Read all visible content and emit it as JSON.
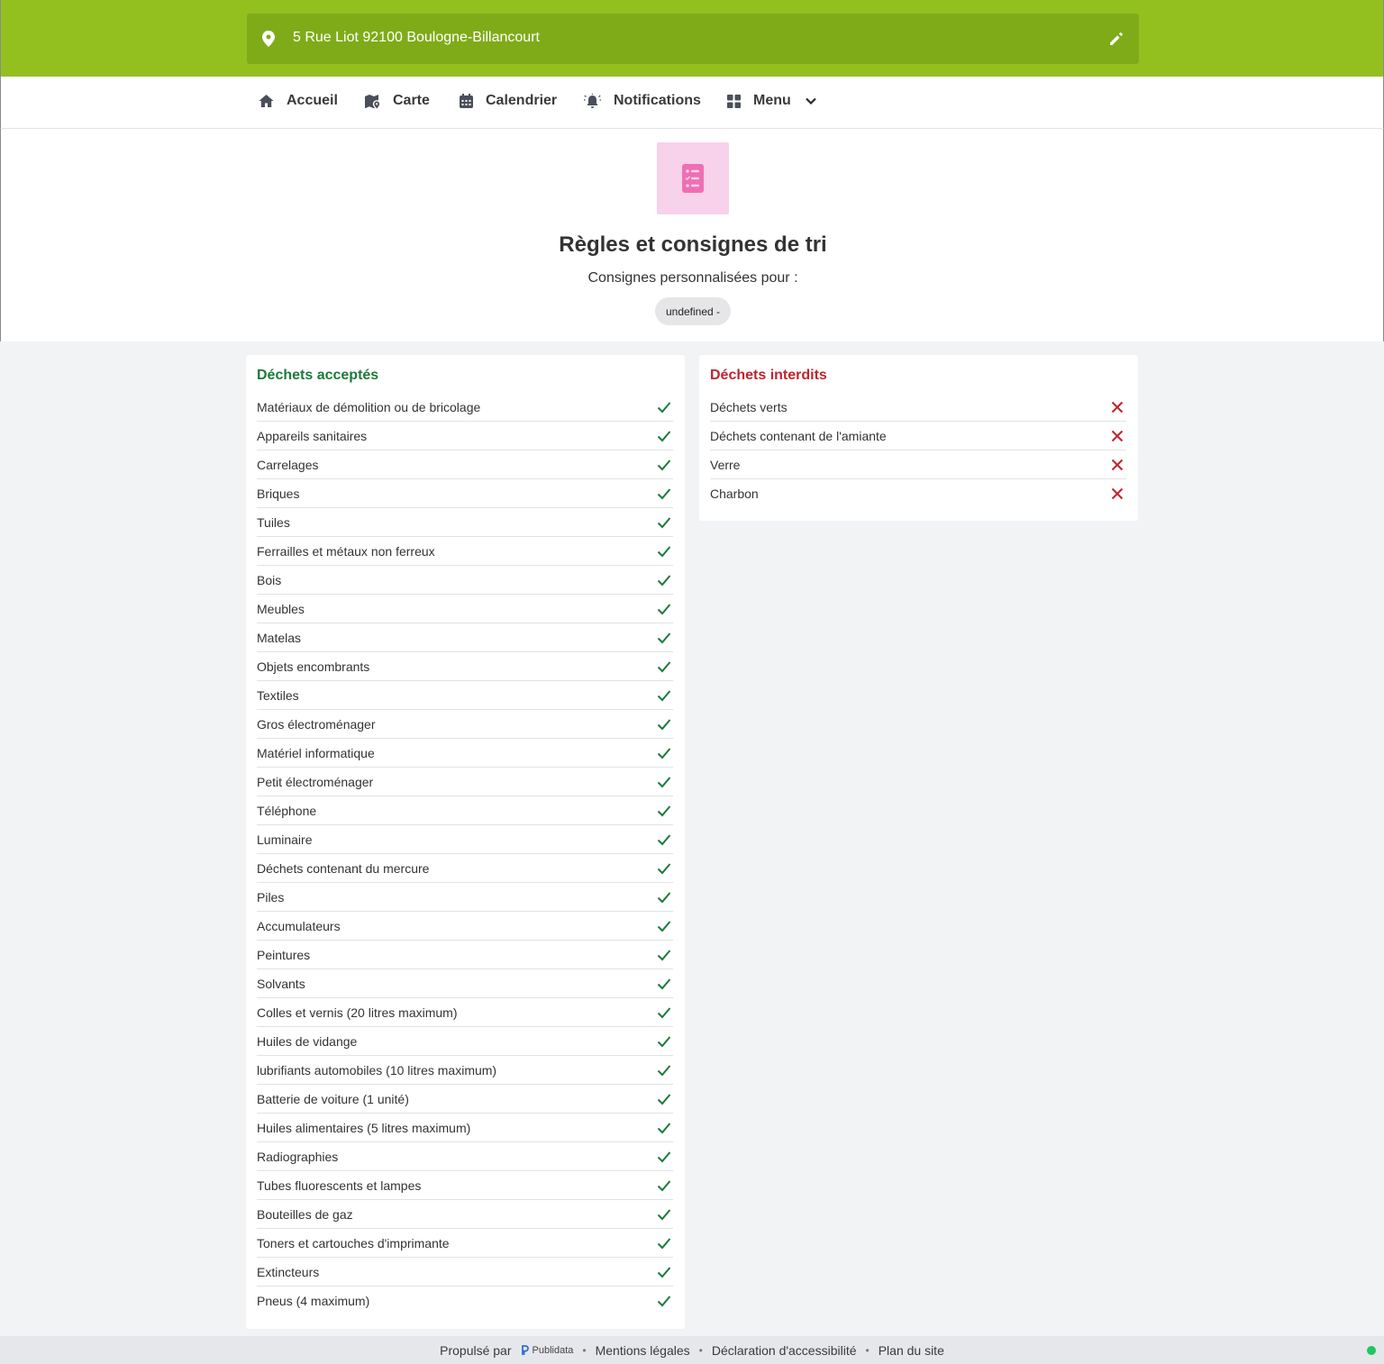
{
  "header": {
    "address": "5 Rue Liot 92100 Boulogne-Billancourt",
    "icons": {
      "location": "location-pin-icon",
      "edit": "pencil-icon"
    }
  },
  "nav": {
    "items": [
      {
        "label": "Accueil",
        "icon": "home-icon"
      },
      {
        "label": "Carte",
        "icon": "map-icon"
      },
      {
        "label": "Calendrier",
        "icon": "calendar-icon"
      },
      {
        "label": "Notifications",
        "icon": "bell-icon"
      },
      {
        "label": "Menu",
        "icon": "grid-icon"
      }
    ]
  },
  "hero": {
    "icon": "checklist-icon",
    "title": "Règles et consignes de tri",
    "subtitle": "Consignes personnalisées pour :",
    "chip": "undefined -"
  },
  "accepted": {
    "title": "Déchets acceptés",
    "items": [
      "Matériaux de démolition ou de bricolage",
      "Appareils sanitaires",
      "Carrelages",
      "Briques",
      "Tuiles",
      "Ferrailles et métaux non ferreux",
      "Bois",
      "Meubles",
      "Matelas",
      "Objets encombrants",
      "Textiles",
      "Gros électroménager",
      "Matériel informatique",
      "Petit électroménager",
      "Téléphone",
      "Luminaire",
      "Déchets contenant du mercure",
      "Piles",
      "Accumulateurs",
      "Peintures",
      "Solvants",
      "Colles et vernis (20 litres maximum)",
      "Huiles de vidange",
      "lubrifiants automobiles (10 litres maximum)",
      "Batterie de voiture (1 unité)",
      "Huiles alimentaires (5 litres maximum)",
      "Radiographies",
      "Tubes fluorescents et lampes",
      "Bouteilles de gaz",
      "Toners et cartouches d'imprimante",
      "Extincteurs",
      "Pneus (4 maximum)"
    ]
  },
  "forbidden": {
    "title": "Déchets interdits",
    "items": [
      "Déchets verts",
      "Déchets contenant de l'amiante",
      "Verre",
      "Charbon"
    ]
  },
  "footer": {
    "powered_by": "Propulsé par",
    "brand": "Publidata",
    "links": [
      "Mentions légales",
      "Déclaration d'accessibilité",
      "Plan du site"
    ]
  },
  "colors": {
    "header": "#93c01f",
    "accepted": "#1d7a3a",
    "forbidden": "#c0232c",
    "hero_icon_bg": "#f7d2ea"
  }
}
